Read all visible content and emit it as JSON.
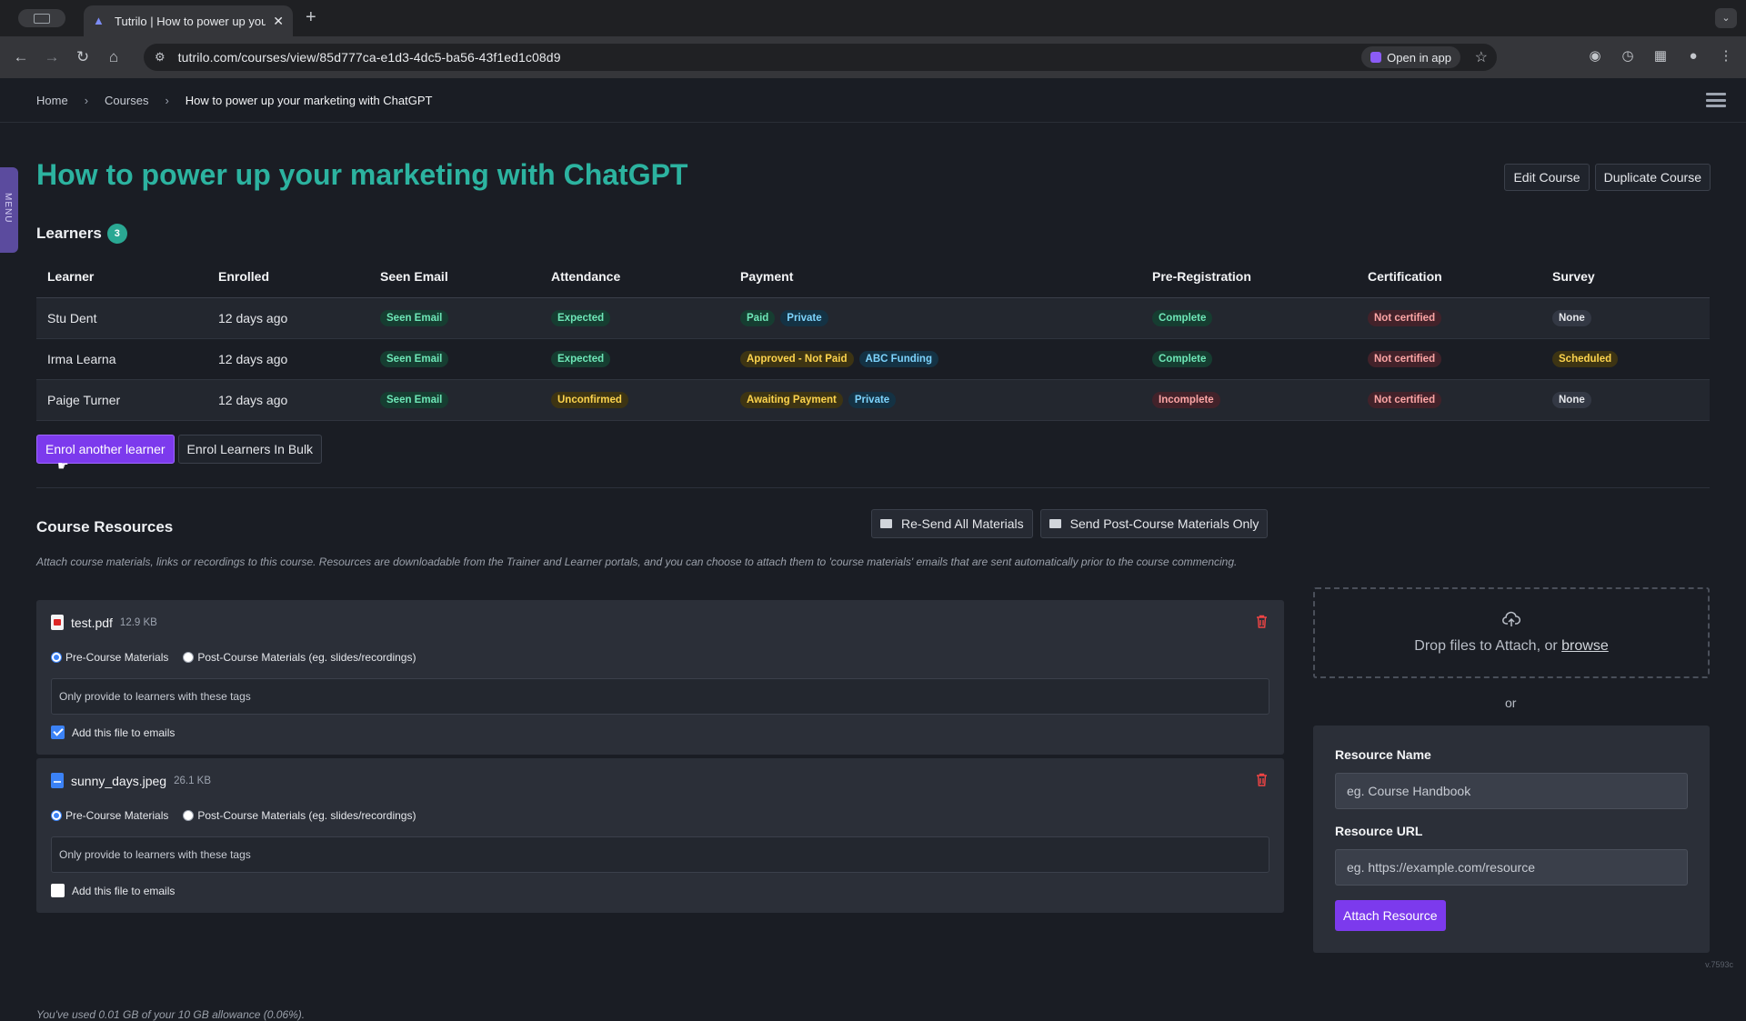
{
  "browser": {
    "tab_title": "Tutrilo | How to power up you",
    "url": "tutrilo.com/courses/view/85d777ca-e1d3-4dc5-ba56-43f1ed1c08d9",
    "open_in_app": "Open in app"
  },
  "breadcrumb": [
    "Home",
    "Courses",
    "How to power up your marketing with ChatGPT"
  ],
  "side_menu_label": "MENU",
  "title": "How to power up your marketing with ChatGPT",
  "header_buttons": {
    "edit": "Edit Course",
    "duplicate": "Duplicate Course"
  },
  "learners": {
    "heading": "Learners",
    "count": "3",
    "columns": [
      "Learner",
      "Enrolled",
      "Seen Email",
      "Attendance",
      "Payment",
      "Pre-Registration",
      "Certification",
      "Survey"
    ],
    "rows": [
      {
        "name": "Stu Dent",
        "enrolled": "12 days ago",
        "seen": "Seen Email",
        "attendance": "Expected",
        "payment": [
          "Paid",
          "Private"
        ],
        "prereg": "Complete",
        "cert": "Not certified",
        "survey": "None"
      },
      {
        "name": "Irma Learna",
        "enrolled": "12 days ago",
        "seen": "Seen Email",
        "attendance": "Expected",
        "payment": [
          "Approved - Not Paid",
          "ABC Funding"
        ],
        "prereg": "Complete",
        "cert": "Not certified",
        "survey": "Scheduled"
      },
      {
        "name": "Paige Turner",
        "enrolled": "12 days ago",
        "seen": "Seen Email",
        "attendance": "Unconfirmed",
        "payment": [
          "Awaiting Payment",
          "Private"
        ],
        "prereg": "Incomplete",
        "cert": "Not certified",
        "survey": "None"
      }
    ]
  },
  "enrol_buttons": {
    "another": "Enrol another learner",
    "bulk": "Enrol Learners In Bulk"
  },
  "resources": {
    "heading": "Course Resources",
    "resend_all": "Re-Send All Materials",
    "send_post": "Send Post-Course Materials Only",
    "description": "Attach course materials, links or recordings to this course. Resources are downloadable from the Trainer and Learner portals, and you can choose to attach them to 'course materials' emails that are sent automatically prior to the course commencing.",
    "pre_label": "Pre-Course Materials",
    "post_label": "Post-Course Materials (eg. slides/recordings)",
    "tags_placeholder": "Only provide to learners with these tags",
    "add_to_emails": "Add this file to emails",
    "files": [
      {
        "name": "test.pdf",
        "size": "12.9 KB",
        "type": "pdf",
        "add_to_emails": true
      },
      {
        "name": "sunny_days.jpeg",
        "size": "26.1 KB",
        "type": "image",
        "add_to_emails": false
      }
    ],
    "usage": "You've used 0.01 GB of your 10 GB allowance (0.06%)."
  },
  "dropzone": {
    "text": "Drop files to Attach, or ",
    "browse": "browse",
    "or": "or"
  },
  "url_form": {
    "name_label": "Resource Name",
    "name_placeholder": "eg. Course Handbook",
    "url_label": "Resource URL",
    "url_placeholder": "eg. https://example.com/resource",
    "attach": "Attach Resource"
  },
  "version": "v.7593c",
  "colors": {
    "accent": "#7c3aed",
    "title": "#2cb3a0",
    "background": "#1a1d24"
  }
}
